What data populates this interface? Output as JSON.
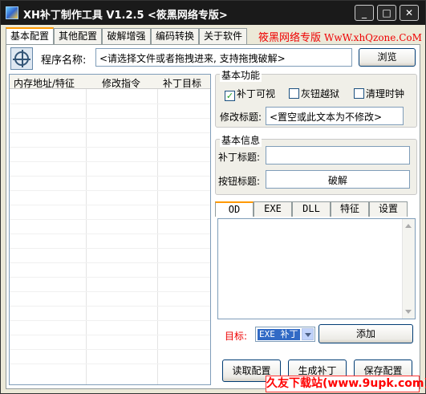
{
  "window": {
    "title": "XH补丁制作工具 V1.2.5 <筱黑网络专版>",
    "controls": {
      "minimize": "_",
      "maximize": "□",
      "close": "✕"
    }
  },
  "tabs": [
    "基本配置",
    "其他配置",
    "破解增强",
    "编码转换",
    "关于软件"
  ],
  "brand": {
    "text": "筱黑网络专版",
    "url": "WwW.xhQzone.CoM"
  },
  "program": {
    "label": "程序名称:",
    "value": "<请选择文件或者拖拽进来, 支持拖拽破解>",
    "browse": "浏览"
  },
  "list": {
    "columns": [
      "内存地址/特征",
      "修改指令",
      "补丁目标"
    ]
  },
  "basic_features": {
    "title": "基本功能",
    "checkboxes": [
      {
        "label": "补丁可视",
        "checked": true
      },
      {
        "label": "灰钮越狱",
        "checked": false
      },
      {
        "label": "清理时钟",
        "checked": false
      }
    ],
    "modify_title_label": "修改标题:",
    "modify_title_value": "<置空或此文本为不修改>"
  },
  "basic_info": {
    "title": "基本信息",
    "patch_title_label": "补丁标题:",
    "patch_title_value": "",
    "button_title_label": "按钮标题:",
    "button_title_value": "破解"
  },
  "subtabs": [
    "OD",
    "EXE",
    "DLL",
    "特征",
    "设置"
  ],
  "target": {
    "label": "目标:",
    "value": "EXE 补丁",
    "add": "添加"
  },
  "actions": {
    "read": "读取配置",
    "generate": "生成补丁",
    "save": "保存配置"
  },
  "watermark": "久友下载站(www.9upk.com)",
  "icons": {
    "app": "app-logo-icon",
    "target": "crosshair-target-icon"
  }
}
